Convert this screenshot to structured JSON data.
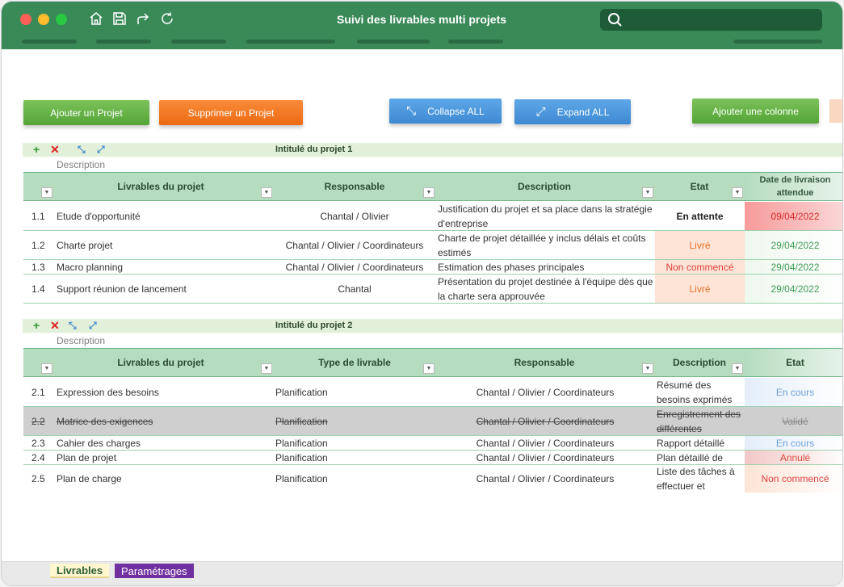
{
  "window": {
    "title": "Suivi des livrables multi projets"
  },
  "toolbar": {
    "add_project": "Ajouter un Projet",
    "delete_project": "Supprimer un Projet",
    "collapse_all": "Collapse ALL",
    "expand_all": "Expand ALL",
    "add_column": "Ajouter une colonne"
  },
  "colors": {
    "accent_green": "#3a8a58",
    "header_green": "#b5dcbf",
    "tab_purple": "#7030a0"
  },
  "project1": {
    "title": "Intitulé du projet 1",
    "description_label": "Description",
    "headers": {
      "deliverables": "Livrables du projet",
      "owner": "Responsable",
      "description": "Description",
      "state": "Etat",
      "due_date": "Date de livraison attendue"
    },
    "rows": [
      {
        "num": "1.1",
        "name": "Etude d'opportunité",
        "owner": "Chantal / Olivier",
        "desc": "Justification du projet et sa place dans la stratégie d'entreprise",
        "state": "En attente",
        "date": "09/04/2022"
      },
      {
        "num": "1.2",
        "name": "Charte projet",
        "owner": "Chantal / Olivier / Coordinateurs",
        "desc": "Charte de projet détaillée y inclus délais et coûts estimés",
        "state": "Livré",
        "date": "29/04/2022"
      },
      {
        "num": "1.3",
        "name": "Macro planning",
        "owner": "Chantal / Olivier / Coordinateurs",
        "desc": "Estimation des phases principales",
        "state": "Non commencé",
        "date": "29/04/2022"
      },
      {
        "num": "1.4",
        "name": "Support réunion de lancement",
        "owner": "Chantal",
        "desc": "Présentation du projet destinée à l'équipe dès que la charte sera approuvée",
        "state": "Livré",
        "date": "29/04/2022"
      }
    ]
  },
  "project2": {
    "title": "Intitulé du projet 2",
    "description_label": "Description",
    "headers": {
      "deliverables": "Livrables du projet",
      "type": "Type de livrable",
      "owner": "Responsable",
      "description": "Description",
      "state": "Etat"
    },
    "rows": [
      {
        "num": "2.1",
        "name": "Expression des besoins",
        "type": "Planification",
        "owner": "Chantal / Olivier / Coordinateurs",
        "desc": "Résumé des besoins exprimés",
        "state": "En cours"
      },
      {
        "num": "2.2",
        "name": "Matrice des exigences",
        "type": "Planification",
        "owner": "Chantal / Olivier / Coordinateurs",
        "desc": "Enregistrement des différentes",
        "state": "Validé"
      },
      {
        "num": "2.3",
        "name": "Cahier des charges",
        "type": "Planification",
        "owner": "Chantal / Olivier / Coordinateurs",
        "desc": "Rapport détaillé",
        "state": "En cours"
      },
      {
        "num": "2.4",
        "name": "Plan de projet",
        "type": "Planification",
        "owner": "Chantal / Olivier / Coordinateurs",
        "desc": "Plan détaillé de",
        "state": "Annulé"
      },
      {
        "num": "2.5",
        "name": "Plan de charge",
        "type": "Planification",
        "owner": "Chantal / Olivier / Coordinateurs",
        "desc": "Liste des tâches à effectuer et",
        "state": "Non commencé"
      }
    ]
  },
  "sheets": {
    "tab1": "Livrables",
    "tab2": "Paramétrages"
  }
}
